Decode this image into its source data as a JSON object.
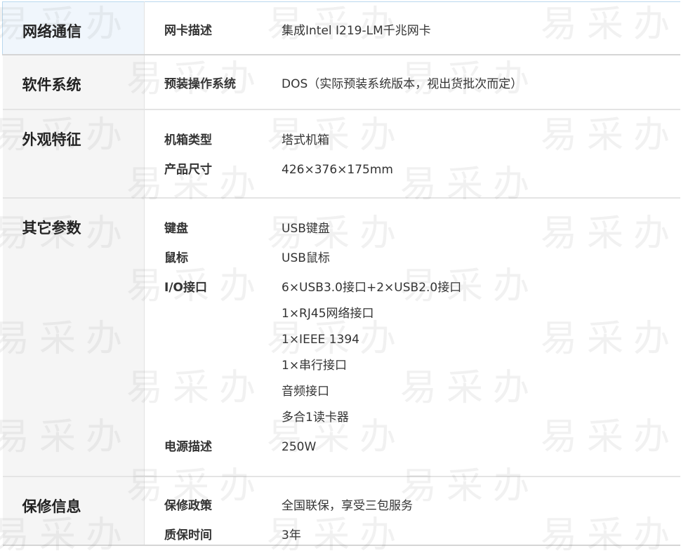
{
  "watermark": "易采办",
  "groups": [
    {
      "category": "网络通信",
      "items": [
        {
          "key": "网卡描述",
          "values": [
            "集成Intel I219-LM千兆网卡"
          ]
        }
      ]
    },
    {
      "category": "软件系统",
      "items": [
        {
          "key": "预装操作系统",
          "values": [
            "DOS（实际预装系统版本，视出货批次而定）"
          ]
        }
      ]
    },
    {
      "category": "外观特征",
      "items": [
        {
          "key": "机箱类型",
          "values": [
            "塔式机箱"
          ]
        },
        {
          "key": "产品尺寸",
          "values": [
            "426×376×175mm"
          ]
        }
      ]
    },
    {
      "category": "其它参数",
      "items": [
        {
          "key": "键盘",
          "values": [
            "USB键盘"
          ]
        },
        {
          "key": "鼠标",
          "values": [
            "USB鼠标"
          ]
        },
        {
          "key": "I/O接口",
          "values": [
            "6×USB3.0接口+2×USB2.0接口",
            "1×RJ45网络接口",
            "1×IEEE 1394",
            "1×串行接口",
            "音频接口",
            "多合1读卡器"
          ]
        },
        {
          "key": "电源描述",
          "values": [
            "250W"
          ]
        }
      ]
    },
    {
      "category": "保修信息",
      "items": [
        {
          "key": "保修政策",
          "values": [
            "全国联保，享受三包服务"
          ]
        },
        {
          "key": "质保时间",
          "values": [
            "3年"
          ]
        }
      ]
    }
  ]
}
